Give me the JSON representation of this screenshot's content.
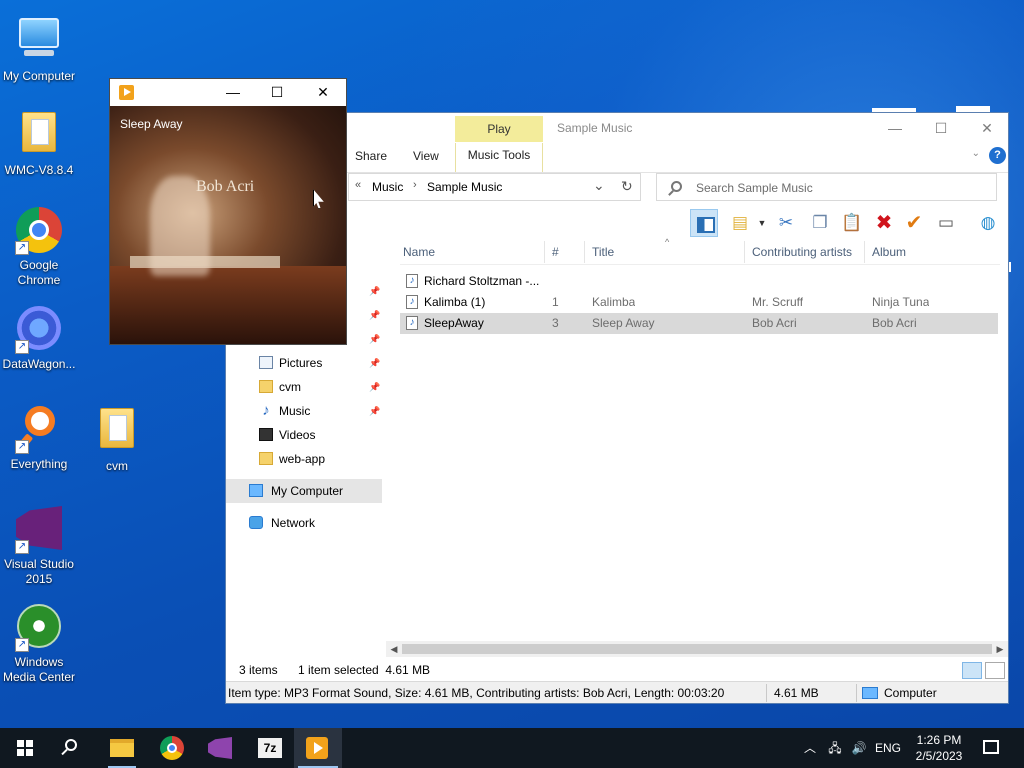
{
  "desktop": {
    "icons": [
      {
        "label": "My Computer"
      },
      {
        "label": "WMC-V8.8.4"
      },
      {
        "label": "Google Chrome"
      },
      {
        "label": "DataWagon..."
      },
      {
        "label": "Everything"
      },
      {
        "label": "cvm"
      },
      {
        "label": "Visual Studio 2015"
      },
      {
        "label": "Windows Media Center"
      }
    ]
  },
  "player": {
    "track_title": "Sleep Away",
    "minimize_glyph": "—",
    "maximize_glyph": "☐",
    "close_glyph": "✕",
    "album_artist_text": "Bob Acri"
  },
  "explorer": {
    "title": "Sample Music",
    "context_tab_group": "Play",
    "ribbon_tabs": {
      "share": "Share",
      "view": "View",
      "music_tools": "Music Tools"
    },
    "address": {
      "overflow": "«",
      "segments": [
        "Music",
        "Sample Music"
      ],
      "sep": "›",
      "dropdown": "⌄",
      "refresh": "↻"
    },
    "search_placeholder": "Search Sample Music",
    "nav": [
      {
        "label": "Pictures",
        "pinned": true
      },
      {
        "label": "cvm",
        "pinned": true
      },
      {
        "label": "Music",
        "pinned": true
      },
      {
        "label": "Videos",
        "pinned": false
      },
      {
        "label": "web-app",
        "pinned": false
      },
      {
        "label": "My Computer",
        "pinned": false
      },
      {
        "label": "Network",
        "pinned": false
      }
    ],
    "pin_glyph": "📌",
    "columns": {
      "name": "Name",
      "num": "#",
      "title": "Title",
      "artists": "Contributing artists",
      "album": "Album"
    },
    "rows": [
      {
        "name": "Richard Stoltzman -...",
        "num": "",
        "title": "",
        "artists": "",
        "album": ""
      },
      {
        "name": "Kalimba (1)",
        "num": "1",
        "title": "Kalimba",
        "artists": "Mr. Scruff",
        "album": "Ninja Tuna"
      },
      {
        "name": "SleepAway",
        "num": "3",
        "title": "Sleep Away",
        "artists": "Bob Acri",
        "album": "Bob Acri"
      }
    ],
    "status": {
      "items": "3 items",
      "selected": "1 item selected  4.61 MB"
    },
    "info": {
      "details": "Item type: MP3 Format Sound, Size: 4.61 MB, Contributing artists: Bob Acri, Length: 00:03:20",
      "size": "4.61 MB",
      "location": "Computer"
    },
    "window_glyphs": {
      "min": "—",
      "max": "☐",
      "close": "✕"
    }
  },
  "taskbar": {
    "lang": "ENG",
    "time": "1:26 PM",
    "date": "2/5/2023",
    "seven_zip_label": "7z"
  },
  "colors": {
    "accent": "#0a5cc6",
    "selection": "#d9d9d9",
    "context_tab": "#f3ec9b"
  }
}
